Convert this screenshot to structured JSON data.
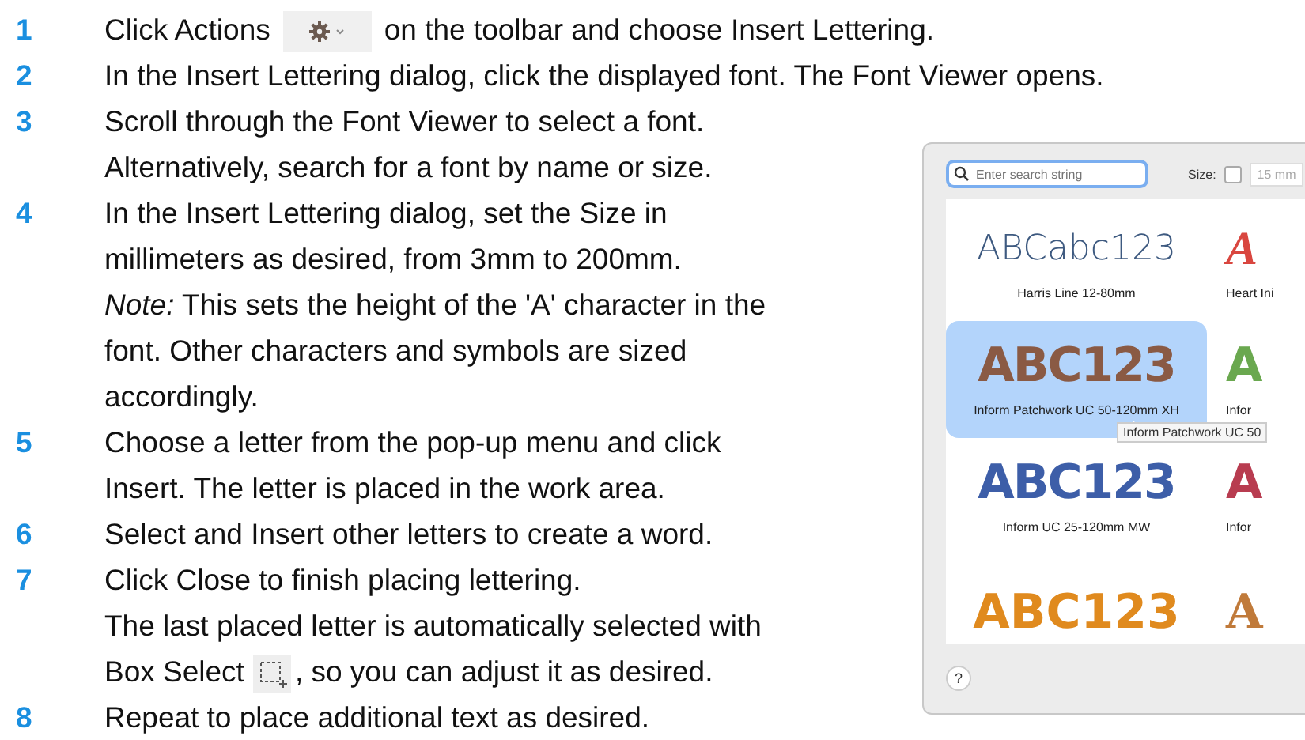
{
  "steps": [
    {
      "number": "1",
      "paragraphs": [
        [
          {
            "kind": "text",
            "text": "Click Actions"
          },
          {
            "kind": "gear-menu"
          },
          {
            "kind": "text",
            "text": "on the toolbar and choose Insert Lettering."
          }
        ]
      ]
    },
    {
      "number": "2",
      "paragraphs": [
        [
          {
            "kind": "text",
            "text": "In the Insert Lettering dialog, click the displayed font. The Font Viewer opens."
          }
        ]
      ]
    },
    {
      "number": "3",
      "paragraphs": [
        [
          {
            "kind": "text",
            "text": "Scroll through the Font Viewer to select a font."
          }
        ],
        [
          {
            "kind": "text",
            "text": "Alternatively, search for a font by name or size."
          }
        ]
      ]
    },
    {
      "number": "4",
      "paragraphs": [
        [
          {
            "kind": "text",
            "text": "In the Insert Lettering dialog, set the Size in millimeters as desired, from 3mm to 200mm."
          }
        ],
        [
          {
            "kind": "text",
            "text": "*Note:* This sets the height of the 'A' character in the font. Other characters and symbols are sized accordingly."
          }
        ]
      ]
    },
    {
      "number": "5",
      "paragraphs": [
        [
          {
            "kind": "text",
            "text": "Choose a letter from the pop-up menu and click Insert. The letter is placed in the work area."
          }
        ]
      ]
    },
    {
      "number": "6",
      "paragraphs": [
        [
          {
            "kind": "text",
            "text": "Select and Insert other letters to create a word."
          }
        ]
      ]
    },
    {
      "number": "7",
      "paragraphs": [
        [
          {
            "kind": "text",
            "text": "Click Close to finish placing lettering."
          }
        ],
        [
          {
            "kind": "text",
            "text": "The last placed letter is automatically selected with Box Select"
          },
          {
            "kind": "box-select"
          },
          {
            "kind": "text",
            "text": ", so you can adjust it as desired."
          }
        ]
      ]
    },
    {
      "number": "8",
      "paragraphs": [
        [
          {
            "kind": "text",
            "text": "Repeat to place additional text as desired."
          }
        ]
      ]
    }
  ],
  "font_viewer": {
    "search": {
      "placeholder": "Enter search string"
    },
    "size_label": "Size:",
    "size_checked": false,
    "size_value": "15 mm",
    "fonts": [
      {
        "sample": "ABCabc123",
        "name": "Harris Line 12-80mm",
        "color": "#3e5a80",
        "kind": "line",
        "selected": false
      },
      {
        "sample": "A",
        "name": "Heart Ini",
        "color": "#d9463f",
        "kind": "script",
        "selected": false
      },
      {
        "sample": "ABC123",
        "name": "Inform Patchwork UC 50-120mm XH",
        "color": "#8a5a44",
        "kind": "block",
        "selected": true
      },
      {
        "sample": "A",
        "name": "Infor",
        "color": "#6aa84f",
        "kind": "block",
        "selected": false
      },
      {
        "sample": "ABC123",
        "name": "Inform UC 25-120mm MW",
        "color": "#3d5ea8",
        "kind": "block",
        "selected": false
      },
      {
        "sample": "A",
        "name": "Infor",
        "color": "#b83c50",
        "kind": "block",
        "selected": false
      },
      {
        "sample": "ABC123",
        "color": "#e08a1e",
        "kind": "outline",
        "selected": false
      },
      {
        "sample": "A",
        "color": "#c07a3a",
        "kind": "serif",
        "selected": false
      }
    ],
    "tooltip": "Inform Patchwork UC 50",
    "help": "?"
  }
}
